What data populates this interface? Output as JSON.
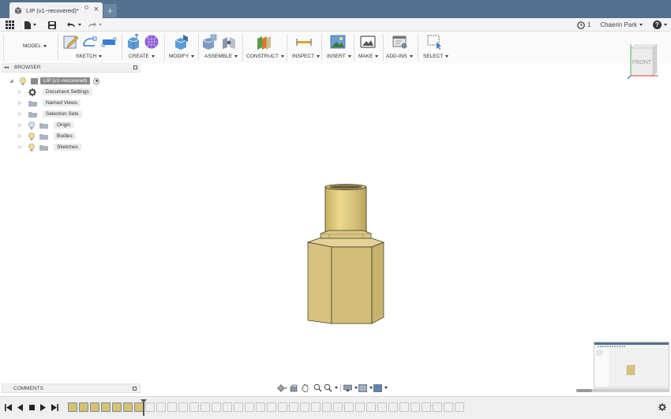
{
  "tab": {
    "title": "LIP (v1~recovered)*",
    "close": "×",
    "new_tab": "+"
  },
  "app_toolbar": {
    "jobs_count": "1",
    "user_name": "Chaerin Park",
    "help": "?"
  },
  "ribbon": {
    "workspace": "MODEL",
    "groups": [
      "SKETCH",
      "CREATE",
      "MODIFY",
      "ASSEMBLE",
      "CONSTRUCT",
      "INSPECT",
      "INSERT",
      "MAKE",
      "ADD-INS",
      "SELECT"
    ]
  },
  "browser": {
    "title": "BROWSER",
    "root": "LIP (v1~recovered)",
    "items": [
      "Document Settings",
      "Named Views",
      "Selection Sets",
      "Origin",
      "Bodies",
      "Sketches"
    ]
  },
  "viewcube": {
    "face": "FRONT"
  },
  "comments": {
    "title": "COMMENTS"
  },
  "colors": {
    "tabbar": "#53718f",
    "body_brass": "#d6c27b",
    "timeline_active": "#d9c26e"
  },
  "icons": {
    "timeline_settings": "gear-icon"
  }
}
